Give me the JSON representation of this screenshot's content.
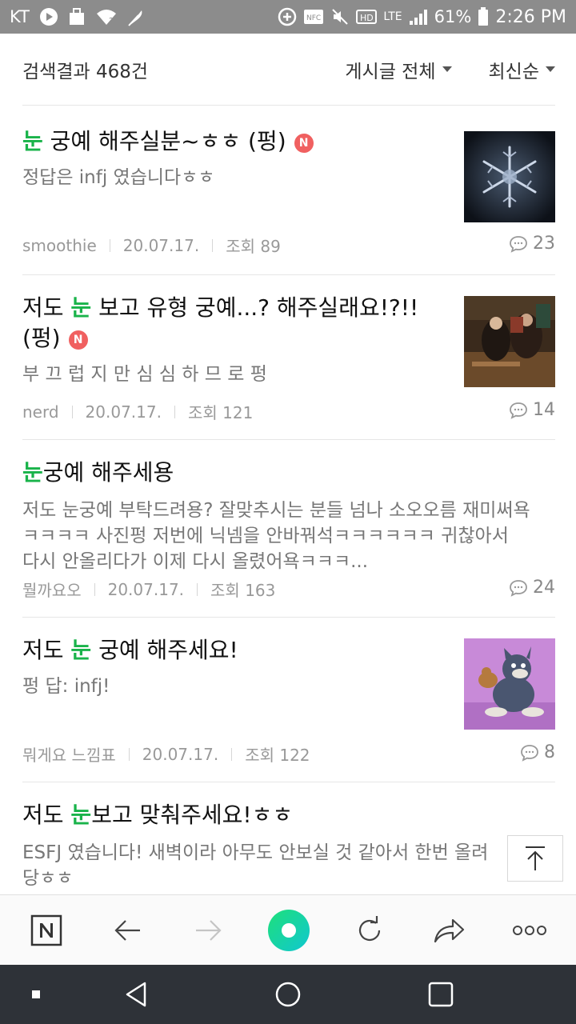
{
  "status_bar": {
    "carrier": "KT",
    "lte": "LTE",
    "battery": "61%",
    "time": "2:26 PM",
    "icons": [
      "play-icon",
      "bag-icon",
      "wifi-question-icon",
      "feather-icon",
      "plus-circle-icon",
      "nfc-icon",
      "mute-icon",
      "hd-icon",
      "signal-icon",
      "battery-icon"
    ]
  },
  "header": {
    "result_count": "검색결과 468건",
    "filter_board": "게시글 전체",
    "filter_sort": "최신순"
  },
  "posts": [
    {
      "title_highlight": "눈",
      "title_rest": " 궁예 해주실분~ㅎㅎ (펑)",
      "new_badge": "N",
      "summary": "정답은 infj 였습니다ㅎㅎ",
      "author": "smoothie",
      "date": "20.07.17.",
      "views": "조회 89",
      "comments": "23",
      "thumbnail": "snowflake-image"
    },
    {
      "title_pre": "저도 ",
      "title_highlight": "눈",
      "title_rest": " 보고 유형 궁예...? 해주실래요!?!!",
      "title_line2": "(펑)",
      "new_badge": "N",
      "summary": "부 끄 럽 지 만 심 심 하 므 로 펑",
      "author": "nerd",
      "date": "20.07.17.",
      "views": "조회 121",
      "comments": "14",
      "thumbnail": "painting-image"
    },
    {
      "title_highlight": "눈",
      "title_rest": "궁예 해주세용",
      "summary_lines": [
        "저도 눈궁예 부탁드려용? 잘맞추시는 분들 넘나 소오오름 재미써욕",
        "ㅋㅋㅋㅋ 사진펑 저번에 닉넴을 안바꿔석ㅋㅋㅋㅋㅋㅋ 귀찮아서",
        "다시 안올리다가 이제 다시 올렸어욕ㅋㅋㅋ..."
      ],
      "author": "뭘까요오",
      "date": "20.07.17.",
      "views": "조회 163",
      "comments": "24"
    },
    {
      "title_pre": "저도 ",
      "title_highlight": "눈",
      "title_rest": " 궁예 해주세요!",
      "summary": "펑 답: infj!",
      "author": "뭐게요 느낌표",
      "date": "20.07.17.",
      "views": "조회 122",
      "comments": "8",
      "thumbnail": "cartoon-cat-image"
    },
    {
      "title_pre": "저도 ",
      "title_highlight": "눈",
      "title_rest": "보고 맞춰주세요!ㅎㅎ",
      "summary_lines": [
        "ESFJ 였습니다! 새벽이라 아무도 안보실 것 같아서 한번 올려",
        "당ㅎㅎ"
      ]
    }
  ],
  "toolbar": {
    "buttons": [
      "naver-home-icon",
      "back-arrow-icon",
      "forward-arrow-icon",
      "green-search-icon",
      "refresh-icon",
      "share-icon",
      "more-icon"
    ],
    "home_label": "N",
    "more_label": "ooo"
  },
  "colors": {
    "highlight": "#19b34a",
    "badge": "#f06060",
    "status_bar": "#8c8c8c",
    "nav_bar": "#2e3238"
  }
}
